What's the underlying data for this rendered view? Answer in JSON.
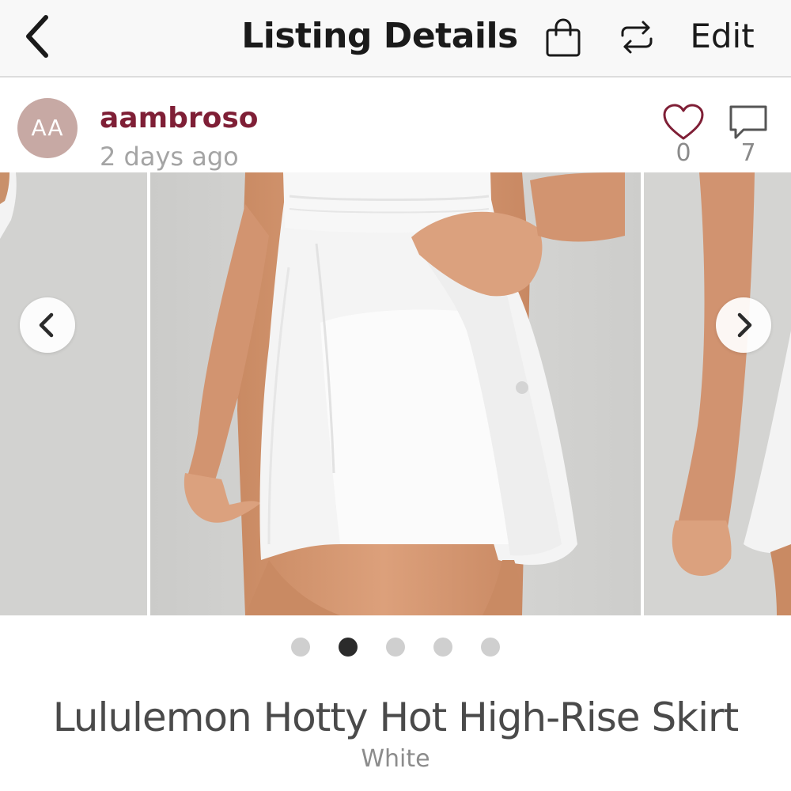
{
  "navbar": {
    "back_icon": "chevron-left-icon",
    "title": "Listing Details",
    "bag_icon": "shopping-bag-icon",
    "share_icon": "repeat-arrows-icon",
    "edit_label": "Edit"
  },
  "seller": {
    "avatar_initials": "AA",
    "avatar_color": "#c7a9a4",
    "username": "aambroso",
    "username_color": "#7f1f36",
    "posted": "2 days ago"
  },
  "engagement": {
    "like_icon": "heart-icon",
    "likes": "0",
    "comment_icon": "speech-bubble-icon",
    "comments": "7"
  },
  "carousel": {
    "prev_icon": "chevron-left-icon",
    "next_icon": "chevron-right-icon",
    "total_slides": 5,
    "active_slide": 2
  },
  "listing": {
    "title": "Lululemon Hotty Hot High-Rise Skirt",
    "color": "White"
  }
}
